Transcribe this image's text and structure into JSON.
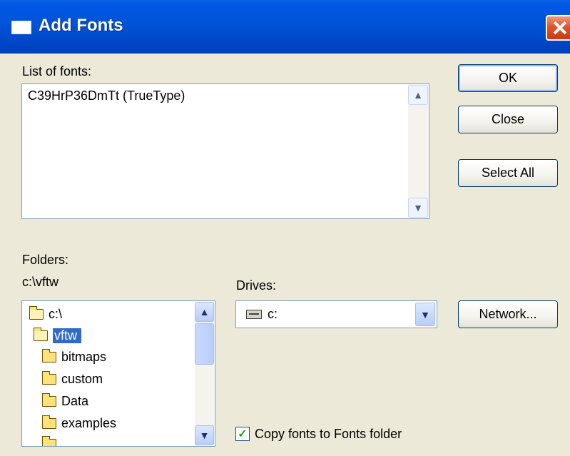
{
  "window": {
    "title": "Add Fonts",
    "close_glyph": "×"
  },
  "fonts": {
    "label": "List of fonts:",
    "items": [
      "C39HrP36DmTt (TrueType)"
    ]
  },
  "buttons": {
    "ok": "OK",
    "close": "Close",
    "select_all": "Select All",
    "network": "Network..."
  },
  "folders": {
    "label": "Folders:",
    "current_path": "c:\\vftw",
    "items": [
      {
        "name": "c:\\",
        "icon": "folder-open-icon"
      },
      {
        "name": "vftw",
        "icon": "folder-open-icon",
        "selected": true
      },
      {
        "name": "bitmaps",
        "icon": "folder-icon"
      },
      {
        "name": "custom",
        "icon": "folder-icon"
      },
      {
        "name": "Data",
        "icon": "folder-icon"
      },
      {
        "name": "examples",
        "icon": "folder-icon"
      }
    ]
  },
  "drives": {
    "label": "Drives:",
    "selected": "c:"
  },
  "copy_option": {
    "label": "Copy fonts to Fonts folder",
    "checked": true
  },
  "colors": {
    "title_bar": "#0054e3",
    "dialog_bg": "#ece9d8",
    "selection": "#316ac5",
    "close_button": "#e3532d"
  }
}
